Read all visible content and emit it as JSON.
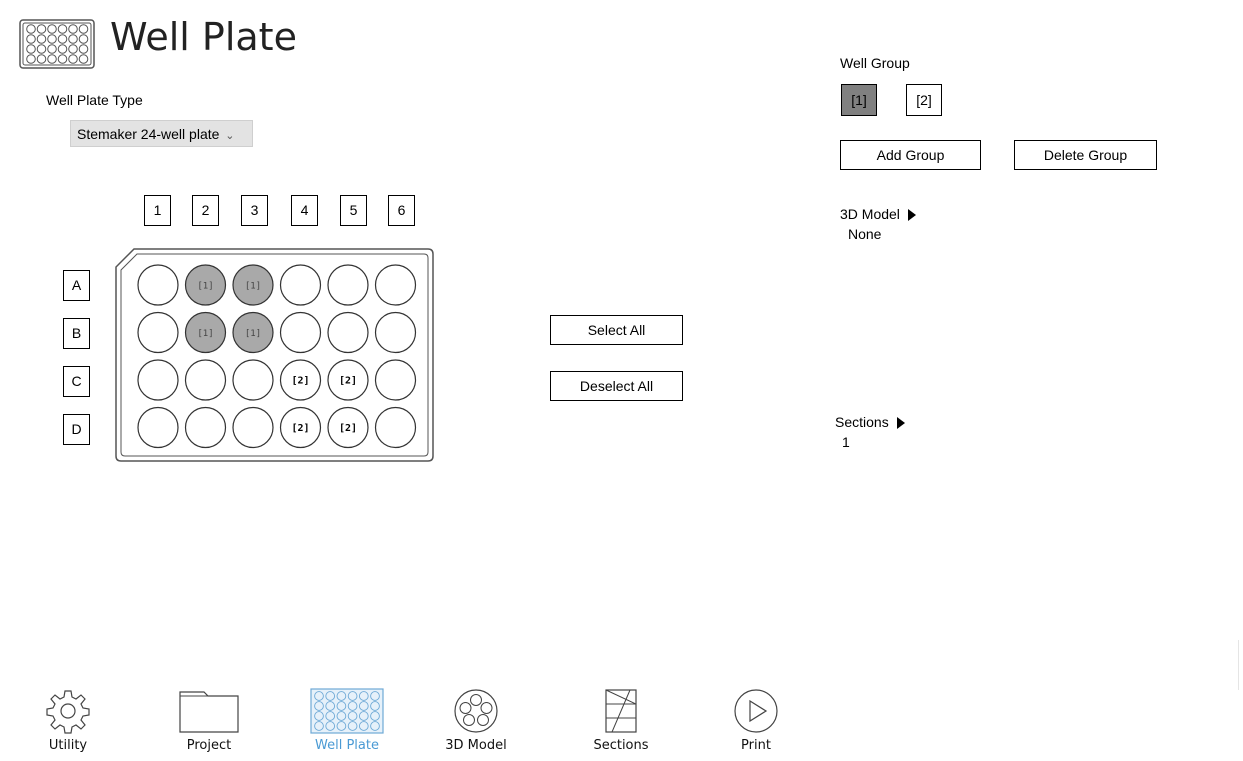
{
  "header": {
    "title": "Well Plate",
    "icon": "well-plate-icon"
  },
  "plate_type": {
    "label": "Well Plate Type",
    "selected": "Stemaker 24-well plate"
  },
  "columns": [
    "1",
    "2",
    "3",
    "4",
    "5",
    "6"
  ],
  "rows": [
    "A",
    "B",
    "C",
    "D"
  ],
  "wells": [
    [
      "",
      "[1]",
      "[1]",
      "",
      "",
      ""
    ],
    [
      "",
      "[1]",
      "[1]",
      "",
      "",
      ""
    ],
    [
      "",
      "",
      "",
      "[2]",
      "[2]",
      ""
    ],
    [
      "",
      "",
      "",
      "[2]",
      "[2]",
      ""
    ]
  ],
  "selection": {
    "select_all": "Select All",
    "deselect_all": "Deselect All"
  },
  "well_group": {
    "label": "Well Group",
    "groups": [
      "[1]",
      "[2]"
    ],
    "active": "[1]",
    "add_label": "Add Group",
    "delete_label": "Delete Group"
  },
  "model": {
    "label": "3D Model",
    "value": "None"
  },
  "sections": {
    "label": "Sections",
    "value": "1"
  },
  "nav": [
    {
      "label": "Utility",
      "icon": "gear-icon"
    },
    {
      "label": "Project",
      "icon": "folder-icon"
    },
    {
      "label": "Well Plate",
      "icon": "well-plate-icon",
      "active": true
    },
    {
      "label": "3D Model",
      "icon": "model-icon"
    },
    {
      "label": "Sections",
      "icon": "sections-icon"
    },
    {
      "label": "Print",
      "icon": "play-icon"
    }
  ],
  "colors": {
    "group1_fill": "#a9a9a9",
    "active_group": "#808080",
    "nav_active": "#4a9ad4"
  }
}
